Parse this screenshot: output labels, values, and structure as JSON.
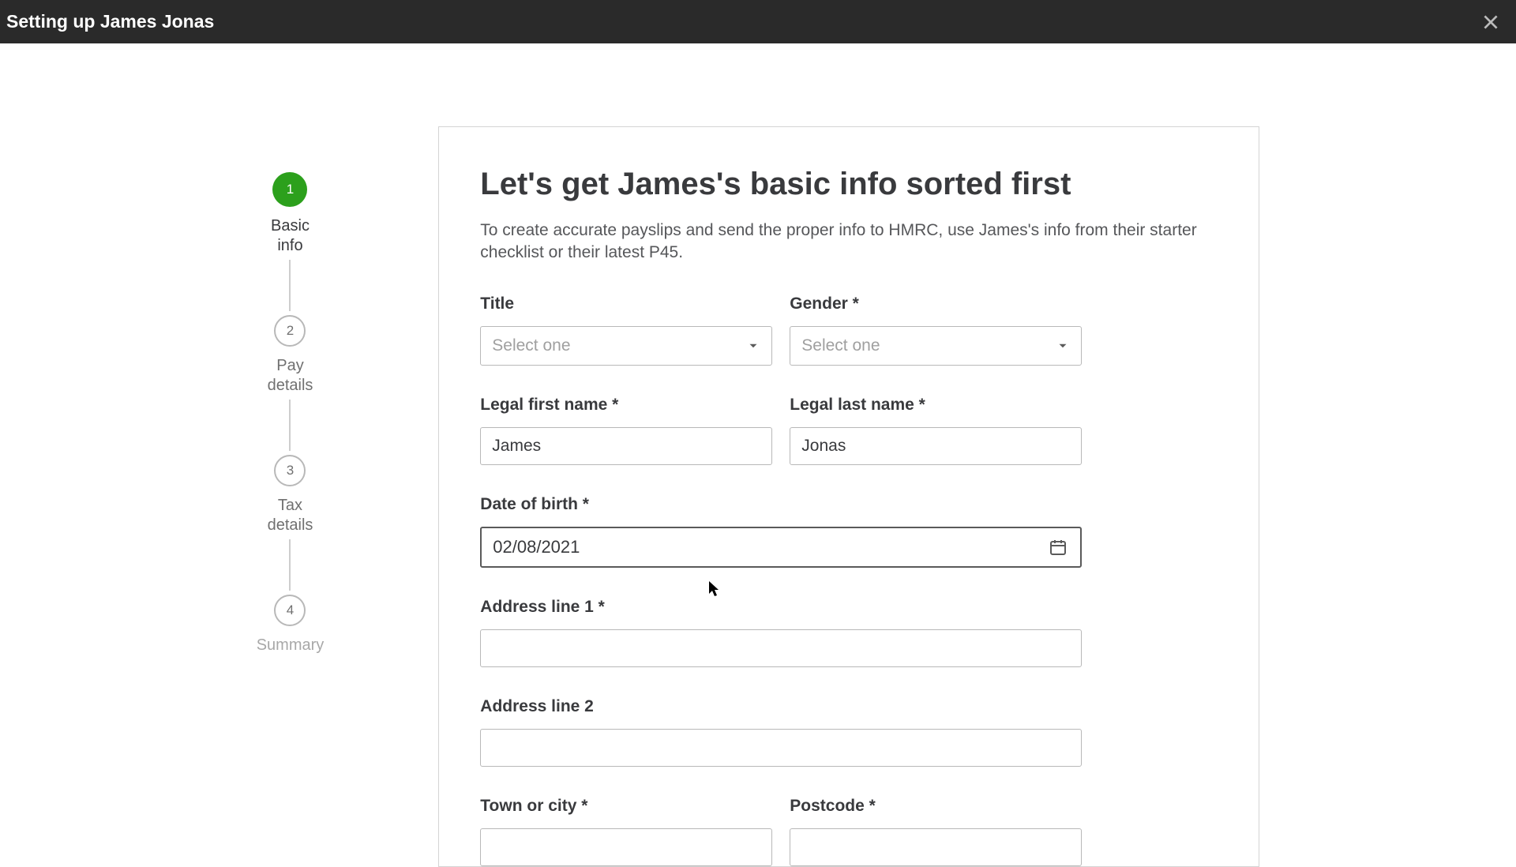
{
  "header": {
    "title": "Setting up James Jonas"
  },
  "stepper": {
    "steps": [
      {
        "number": "1",
        "label": "Basic\ninfo",
        "state": "active"
      },
      {
        "number": "2",
        "label": "Pay\ndetails",
        "state": "inactive"
      },
      {
        "number": "3",
        "label": "Tax\ndetails",
        "state": "inactive"
      },
      {
        "number": "4",
        "label": "Summary",
        "state": "muted"
      }
    ]
  },
  "form": {
    "heading": "Let's get James's basic info sorted first",
    "subtext": "To create accurate payslips and send the proper info to HMRC, use James's info from their starter checklist or their latest P45.",
    "fields": {
      "title": {
        "label": "Title",
        "placeholder": "Select one"
      },
      "gender": {
        "label": "Gender *",
        "placeholder": "Select one"
      },
      "firstName": {
        "label": "Legal first name *",
        "value": "James"
      },
      "lastName": {
        "label": "Legal last name *",
        "value": "Jonas"
      },
      "dob": {
        "label": "Date of birth *",
        "value": "02/08/2021"
      },
      "address1": {
        "label": "Address line 1 *",
        "value": ""
      },
      "address2": {
        "label": "Address line 2",
        "value": ""
      },
      "town": {
        "label": "Town or city *",
        "value": ""
      },
      "postcode": {
        "label": "Postcode *",
        "value": ""
      }
    }
  }
}
